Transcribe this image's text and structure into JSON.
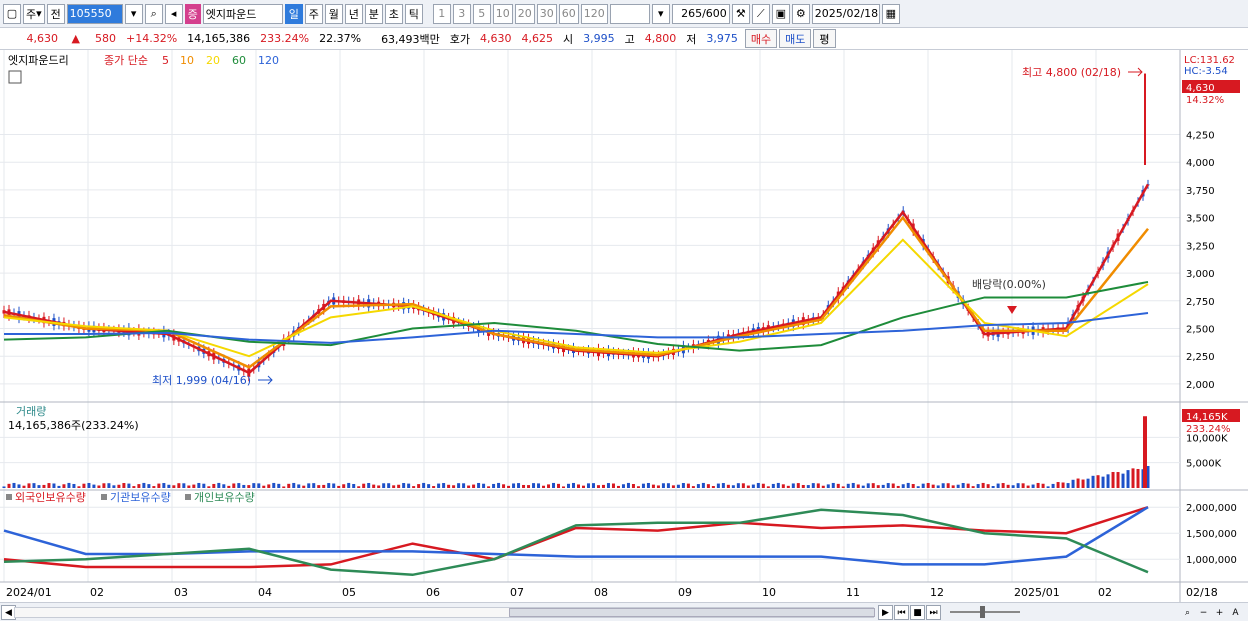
{
  "toolbar": {
    "market_label": "주",
    "prev_label": "전",
    "code": "105550",
    "name_badge": "증",
    "stock_name": "엣지파운드",
    "periods": [
      "일",
      "주",
      "월",
      "년",
      "분",
      "초",
      "틱"
    ],
    "active_period": "일",
    "intervals": [
      "1",
      "3",
      "5",
      "10",
      "20",
      "30",
      "60",
      "120"
    ],
    "count_value": "265",
    "count_total": "/600",
    "date": "2025/02/18"
  },
  "info": {
    "price": "4,630",
    "arrow": "▲",
    "change": "580",
    "change_pct": "+14.32%",
    "volume": "14,165,386",
    "volume_ratio": "233.24%",
    "turnover": "22.37%",
    "amount": "63,493백만",
    "quote_label": "호가",
    "ask": "4,630",
    "bid": "4,625",
    "open_label": "시",
    "open": "3,995",
    "high_label": "고",
    "high": "4,800",
    "low_label": "저",
    "low": "3,975",
    "buy_label": "매수",
    "sell_label": "매도",
    "eval_label": "평"
  },
  "legend": {
    "stock": "엣지파운드리",
    "ma_label": "종가 단순",
    "ma_periods": [
      "5",
      "10",
      "20",
      "60",
      "120"
    ],
    "ma_colors": [
      "#d71921",
      "#f08c00",
      "#f5d800",
      "#1e8c3a",
      "#2d63d8"
    ]
  },
  "price_axis": {
    "ticks": [
      "4,250",
      "4,000",
      "3,750",
      "3,500",
      "3,250",
      "3,000",
      "2,750",
      "2,500",
      "2,250",
      "2,000"
    ],
    "lc": "LC:131.62",
    "hc": "HC:-3.54",
    "current": "4,630",
    "current_pct": "14.32%"
  },
  "annotations": {
    "high": "최고 4,800 (02/18)",
    "low": "최저 1,999 (04/16)",
    "ex_rights": "배당락(0.00%)"
  },
  "volume_panel": {
    "title": "거래량",
    "value": "14,165,386주(233.24%)",
    "ticks": [
      "10,000K",
      "5,000K"
    ],
    "current": "14,165K",
    "current_pct": "233.24%"
  },
  "holdings_panel": {
    "series": [
      "외국인보유수량",
      "기관보유수량",
      "개인보유수량"
    ],
    "ticks": [
      "2,000,000",
      "1,500,000",
      "1,000,000"
    ]
  },
  "x_axis": {
    "labels": [
      "2024/01",
      "02",
      "03",
      "04",
      "05",
      "06",
      "07",
      "08",
      "09",
      "10",
      "11",
      "12",
      "2025/01",
      "02"
    ],
    "end_label": "02/18"
  },
  "colors": {
    "up": "#d71921",
    "down": "#1e50c8",
    "accent": "#2f7bdc"
  },
  "chart_data": {
    "type": "line",
    "title": "엣지파운드리",
    "x": [
      "2024/01",
      "02",
      "03",
      "04",
      "05",
      "06",
      "07",
      "08",
      "09",
      "10",
      "11",
      "12",
      "2025/01",
      "02",
      "02/18"
    ],
    "series": [
      {
        "name": "5",
        "values": [
          2650,
          2500,
          2450,
          2100,
          2750,
          2700,
          2450,
          2300,
          2250,
          2450,
          2600,
          3550,
          2450,
          2500,
          3800
        ]
      },
      {
        "name": "10",
        "values": [
          2620,
          2500,
          2480,
          2150,
          2700,
          2720,
          2450,
          2310,
          2260,
          2430,
          2580,
          3500,
          2480,
          2480,
          3400
        ]
      },
      {
        "name": "20",
        "values": [
          2600,
          2520,
          2480,
          2250,
          2600,
          2700,
          2480,
          2330,
          2280,
          2380,
          2550,
          3300,
          2550,
          2430,
          2900
        ]
      },
      {
        "name": "60",
        "values": [
          2400,
          2420,
          2480,
          2380,
          2350,
          2500,
          2550,
          2480,
          2360,
          2300,
          2350,
          2600,
          2780,
          2780,
          2920
        ]
      },
      {
        "name": "120",
        "values": [
          2450,
          2450,
          2460,
          2400,
          2370,
          2420,
          2480,
          2450,
          2420,
          2420,
          2450,
          2480,
          2530,
          2550,
          2640
        ]
      }
    ],
    "ylim": [
      1900,
      4850
    ],
    "high": {
      "value": 4800,
      "date": "02/18"
    },
    "low": {
      "value": 1999,
      "date": "04/16"
    },
    "volume": {
      "ylim": [
        0,
        15000
      ],
      "last": 14165
    },
    "holdings": {
      "ylim": [
        600000,
        2100000
      ],
      "series": [
        {
          "name": "외국인보유수량",
          "values": [
            1000000,
            850000,
            850000,
            850000,
            900000,
            1300000,
            1000000,
            1600000,
            1550000,
            1700000,
            1600000,
            1650000,
            1550000,
            1500000,
            2000000
          ]
        },
        {
          "name": "기관보유수량",
          "values": [
            1550000,
            1100000,
            1100000,
            1150000,
            1150000,
            1150000,
            1100000,
            1050000,
            1050000,
            1050000,
            1050000,
            900000,
            900000,
            1050000,
            2000000
          ]
        },
        {
          "name": "개인보유수량",
          "values": [
            950000,
            1000000,
            1100000,
            1200000,
            800000,
            700000,
            1000000,
            1650000,
            1700000,
            1700000,
            1950000,
            1850000,
            1500000,
            1400000,
            750000
          ]
        }
      ]
    }
  }
}
